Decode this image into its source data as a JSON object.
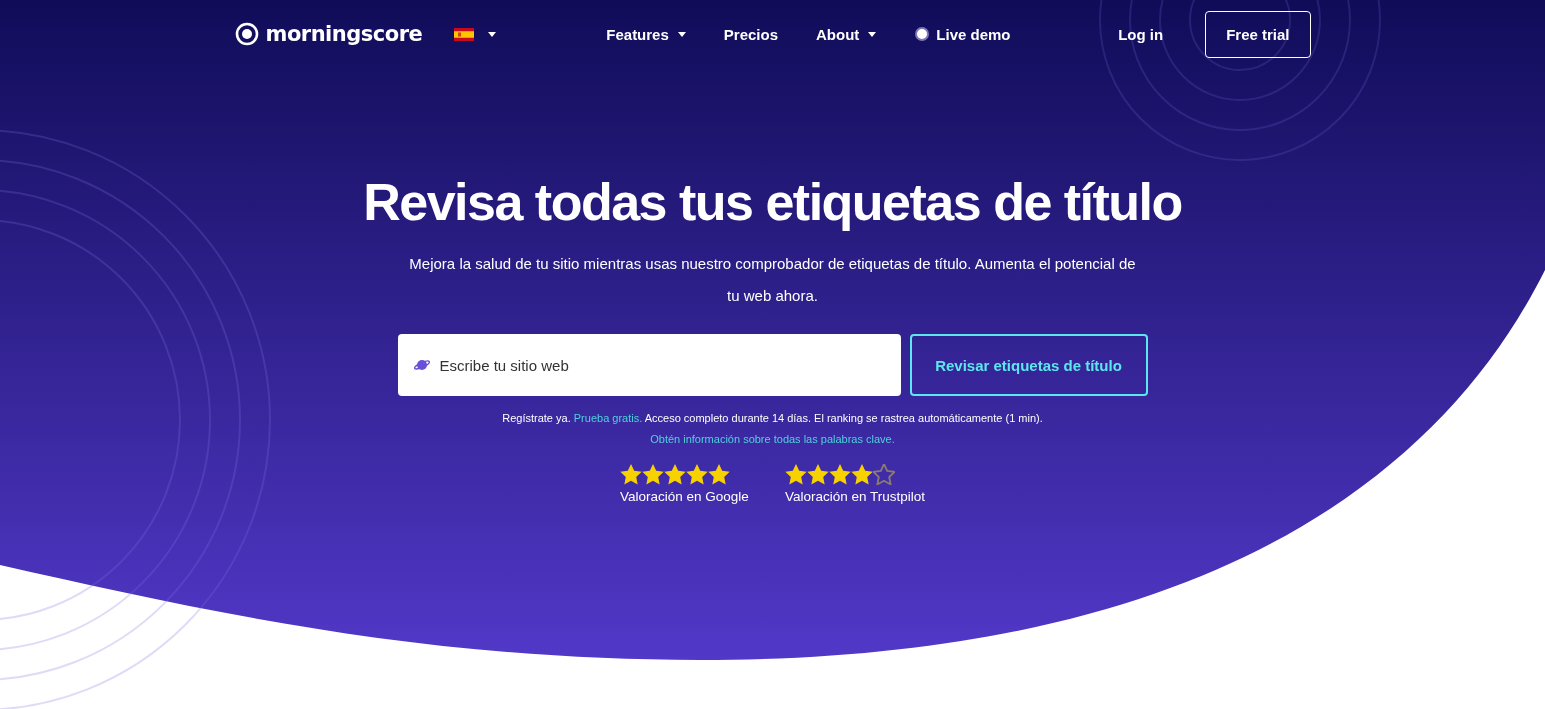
{
  "header": {
    "logo": "morningscore",
    "nav": [
      {
        "label": "Features",
        "dropdown": true
      },
      {
        "label": "Precios",
        "dropdown": false
      },
      {
        "label": "About",
        "dropdown": true
      },
      {
        "label": "Live demo",
        "dropdown": false,
        "kind": "live"
      }
    ],
    "login": "Log in",
    "cta": "Free trial"
  },
  "hero": {
    "title": "Revisa todas tus etiquetas de título",
    "subtitle": "Mejora la salud de tu sitio mientras usas nuestro comprobador de etiquetas de título. Aumenta el potencial de tu web ahora.",
    "search": {
      "placeholder": "Escribe tu sitio web"
    },
    "button": "Revisar etiquetas de título",
    "note": [
      {
        "kind": "text",
        "text": "Regístrate ya. "
      },
      {
        "kind": "link",
        "text": "Prueba gratis."
      },
      {
        "kind": "text",
        "text": " Acceso completo durante 14 días. El ranking se rastrea automáticamente (1 min). "
      },
      {
        "kind": "link",
        "text": "Obtén información sobre todas las palabras clave."
      }
    ],
    "ratings": [
      {
        "label": "Valoración en Google",
        "stars": 5
      },
      {
        "label": "Valoración en Trustpilot",
        "stars": 4
      }
    ]
  }
}
